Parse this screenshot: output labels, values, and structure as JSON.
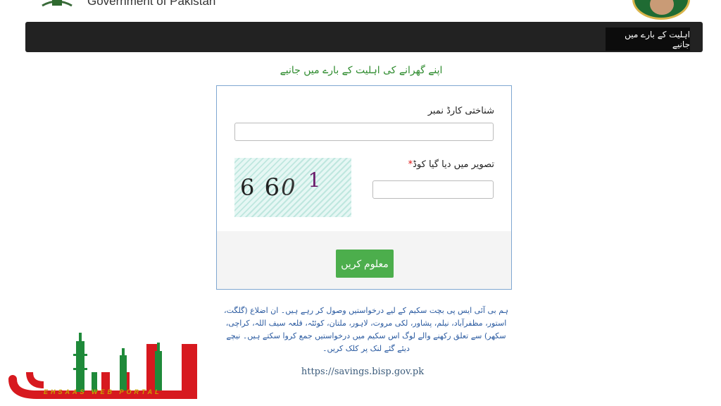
{
  "header": {
    "title": "Government of Pakistan"
  },
  "nav": {
    "item_label": "اہلیت کے بارے میں جانیے"
  },
  "page": {
    "heading": "اپنے گھرانے کی اہلیت کے بارے میں جانیے"
  },
  "form": {
    "cnic_label": "شناختی کارڈ نمبر",
    "captcha_label": "تصویر میں دیا گیا کوڈ",
    "required_mark": "*",
    "captcha_chars": [
      "6",
      "6",
      "0",
      "1"
    ],
    "submit_label": "معلوم کریں"
  },
  "info": {
    "paragraph": "ہم بی آئی ایس پی بچت سکیم کے لیے درخواستیں وصول کر رہے ہیں۔ ان اضلاع (گلگت، استور، مظفرآباد، نیلم، پشاور، لکی مروت، لاہور، ملتان، کوئٹہ، قلعہ سیف اللہ، کراچی، سکھر) سے تعلق رکھنے والے لوگ اس سکیم میں درخواستیں جمع کروا سکتے ہیں۔ نیچے دیئے گئے لنک پر کلک کریں۔",
    "url": "https://savings.bisp.gov.pk"
  },
  "brand": {
    "tagline": "EHSAAS WEB PORTAL",
    "primary_color": "#d7191f",
    "accent_color": "#1f8a3a"
  },
  "colors": {
    "navbar": "#222222",
    "submit": "#4cae4c",
    "heading": "#2e8b2e",
    "info_text": "#2a5aa0"
  }
}
